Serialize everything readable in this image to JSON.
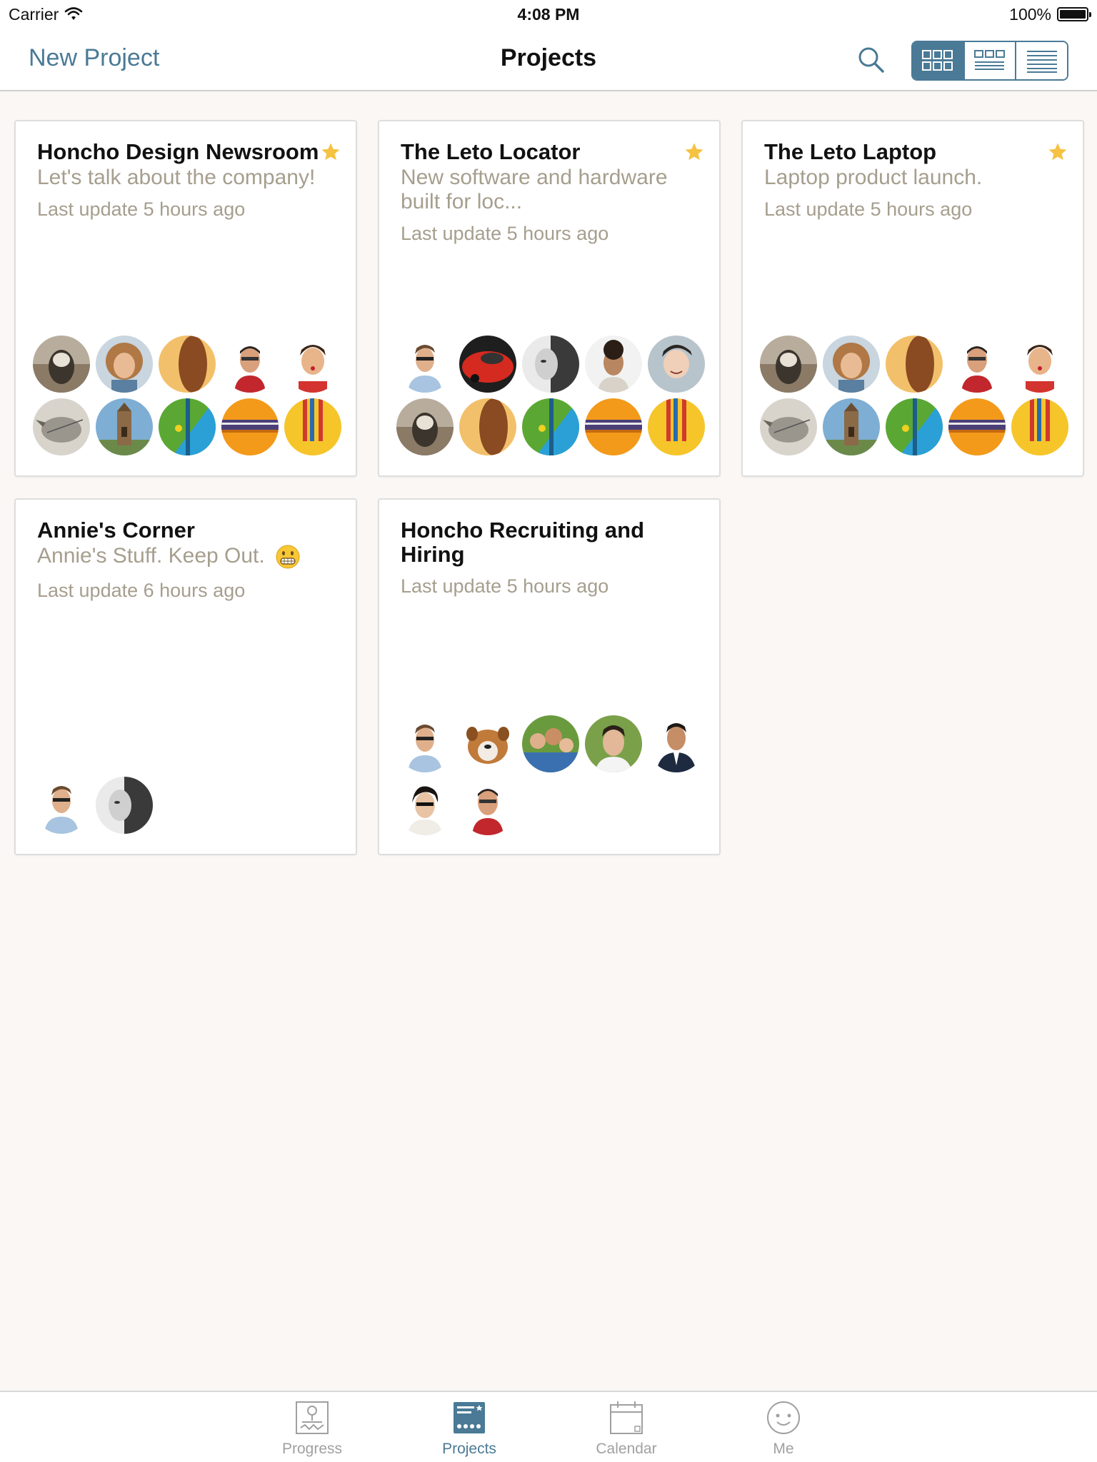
{
  "status_bar": {
    "carrier": "Carrier",
    "time": "4:08 PM",
    "battery": "100%"
  },
  "nav": {
    "new_project": "New Project",
    "title": "Projects",
    "view_modes": [
      "grid-large",
      "grid-list",
      "list"
    ],
    "active_view": "grid-large"
  },
  "projects": [
    {
      "title": "Honcho Design Newsroom",
      "subtitle": "Let's talk about the company!",
      "last_update": "Last update 5 hours ago",
      "starred": true
    },
    {
      "title": "The Leto Locator",
      "subtitle": "New software and hardware built for loc...",
      "last_update": "Last update 5 hours ago",
      "starred": true
    },
    {
      "title": "The Leto Laptop",
      "subtitle": "Laptop product launch.",
      "last_update": "Last update 5 hours ago",
      "starred": true
    },
    {
      "title": "Annie's Corner",
      "subtitle": "Annie's Stuff. Keep Out.",
      "subtitle_emoji": "grimacing-face-emoji",
      "last_update": "Last update 6 hours ago",
      "starred": false
    },
    {
      "title": "Honcho Recruiting and Hiring",
      "subtitle": "",
      "last_update": "Last update 5 hours ago",
      "starred": false
    }
  ],
  "tabs": [
    {
      "label": "Progress",
      "icon": "progress-icon",
      "active": false
    },
    {
      "label": "Projects",
      "icon": "projects-icon",
      "active": true
    },
    {
      "label": "Calendar",
      "icon": "calendar-icon",
      "active": false
    },
    {
      "label": "Me",
      "icon": "smiley-icon",
      "active": false
    }
  ],
  "colors": {
    "accent": "#4a7a96",
    "muted_text": "#a69e8e",
    "background": "#faf7f5",
    "star": "#f5c242"
  }
}
